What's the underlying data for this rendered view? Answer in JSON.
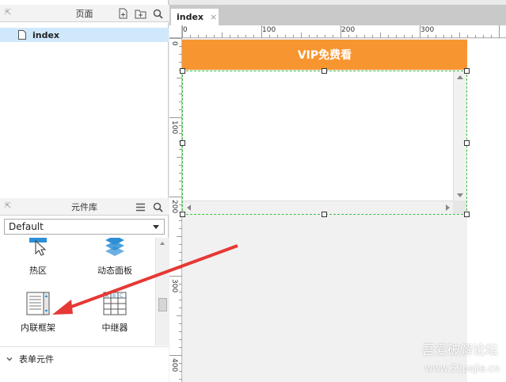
{
  "pages_panel": {
    "title": "页面",
    "pages": [
      {
        "label": "index"
      }
    ]
  },
  "library_panel": {
    "title": "元件库",
    "selected_library": "Default",
    "widgets": [
      {
        "label": "热区",
        "icon": "hotspot-icon"
      },
      {
        "label": "动态面板",
        "icon": "dynamic-panel-icon"
      },
      {
        "label": "内联框架",
        "icon": "inline-frame-icon"
      },
      {
        "label": "中继器",
        "icon": "repeater-icon"
      }
    ],
    "section": {
      "label": "表单元件"
    }
  },
  "editor": {
    "active_tab": "index",
    "ruler_h_ticks": [
      "0",
      "100",
      "200",
      "300"
    ],
    "ruler_v_ticks": [
      "0",
      "100",
      "200",
      "300",
      "400"
    ],
    "banner_text": "VIP免费看"
  },
  "watermark": {
    "line1": "吾爱破解论坛",
    "line2": "www.52pojie.cn"
  },
  "colors": {
    "banner": "#f79530",
    "selection": "#cfe8fb",
    "frame_border": "#3bbf3b",
    "annotation_arrow": "#e53935"
  }
}
